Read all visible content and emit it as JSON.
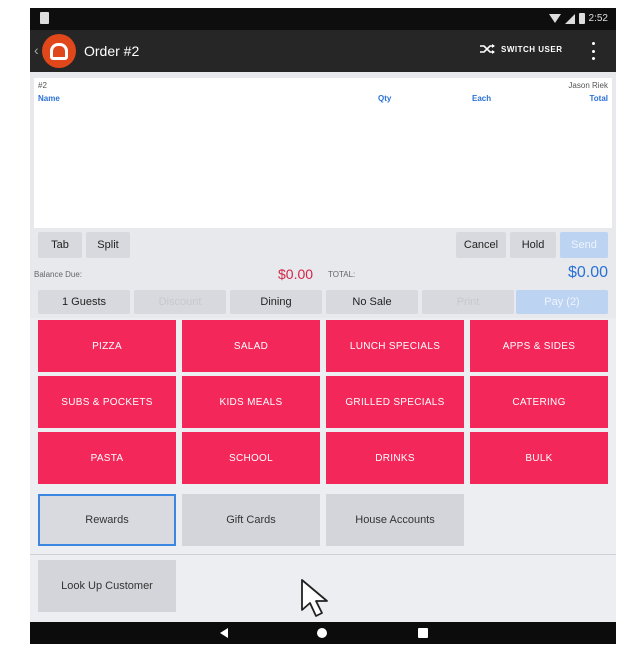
{
  "status_bar": {
    "time": "2:52"
  },
  "app_bar": {
    "back_glyph": "‹",
    "title": "Order #2",
    "switch_user_label": "SWITCH USER",
    "switch_icon": "shuffle-icon",
    "menu_icon": "overflow-menu-icon"
  },
  "order": {
    "number": "#2",
    "server": "Jason Riek",
    "columns": {
      "name": "Name",
      "qty": "Qty",
      "each": "Each",
      "total": "Total"
    }
  },
  "actions": {
    "tab": "Tab",
    "split": "Split",
    "cancel": "Cancel",
    "hold": "Hold",
    "send": "Send"
  },
  "totals": {
    "balance_label": "Balance Due:",
    "balance_value": "$0.00",
    "total_label": "TOTAL:",
    "total_value": "$0.00"
  },
  "bottom_actions": {
    "guests": "1 Guests",
    "discount": "Discount",
    "dining": "Dining",
    "no_sale": "No Sale",
    "print": "Print",
    "pay": "Pay (2)"
  },
  "categories": [
    "PIZZA",
    "SALAD",
    "LUNCH SPECIALS",
    "APPS & SIDES",
    "SUBS & POCKETS",
    "KIDS MEALS",
    "GRILLED SPECIALS",
    "CATERING",
    "PASTA",
    "SCHOOL",
    "DRINKS",
    "BULK"
  ],
  "extras": {
    "rewards": "Rewards",
    "gift_cards": "Gift Cards",
    "house_accounts": "House Accounts"
  },
  "customer": {
    "look_up": "Look Up Customer"
  },
  "colors": {
    "category": "#f4275a",
    "accent_blue": "#2a72d6",
    "balance_red": "#d02548",
    "logo_orange": "#e0481b"
  }
}
